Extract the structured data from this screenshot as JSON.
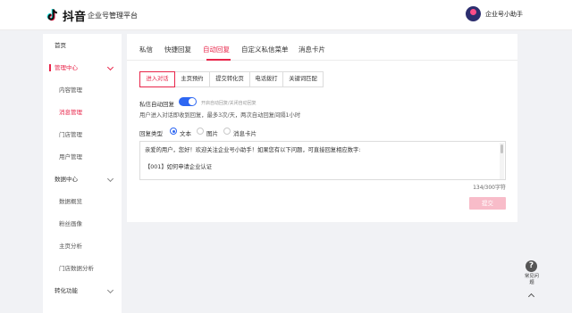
{
  "header": {
    "brand": "抖音",
    "platform": "企业号管理平台",
    "account_name": "企业号小助手"
  },
  "sidebar": {
    "home": "首页",
    "management_center": "管理中心",
    "management_items": [
      "内容管理",
      "消息管理",
      "门店管理",
      "用户管理"
    ],
    "data_center": "数据中心",
    "data_items": [
      "数据概览",
      "粉丝画像",
      "主页分析",
      "门店数据分析"
    ],
    "conversion": "转化功能"
  },
  "tabs": [
    "私信",
    "快捷回复",
    "自动回复",
    "自定义私信菜单",
    "消息卡片"
  ],
  "subtabs": [
    "进入对话",
    "主页预约",
    "提交转化页",
    "电话拨打",
    "关键词匹配"
  ],
  "auto_reply": {
    "toggle_label": "私信自动回复",
    "toggle_hint": "开启自动回复/关闭自动回复",
    "toggle_on": true,
    "rule_note": "用户进入对话即收到回复，最多3次/天，两次自动回复间隔1小时",
    "reply_type_label": "回复类型",
    "reply_types": [
      "文本",
      "图片",
      "消息卡片"
    ],
    "selected_type": "文本",
    "reply_lines": [
      "亲爱的用户，您好！欢迎关注企业号小助手！如果您有以下问题，可直接回复相应数字:",
      "【001】如何申请企业认证"
    ],
    "char_count": "134/300字符",
    "submit_label": "提交"
  },
  "help": {
    "icon_glyph": "?",
    "label": "常见问题"
  },
  "colors": {
    "accent": "#e8254a",
    "toggle": "#2e67f2",
    "submit_disabled": "#f8bcc9"
  }
}
